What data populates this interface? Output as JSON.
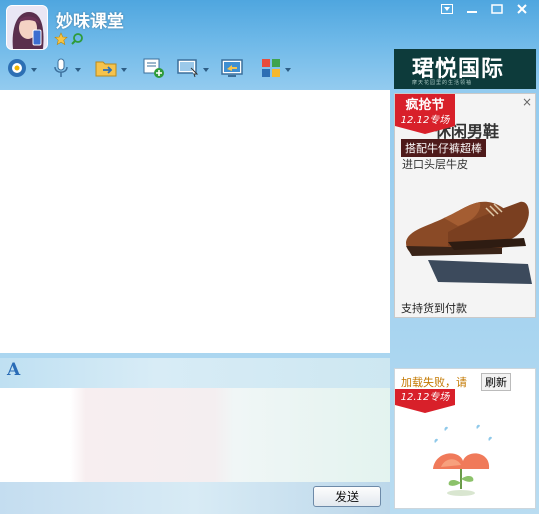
{
  "window": {
    "title": "妙味课堂",
    "controls": [
      {
        "name": "skin-icon"
      },
      {
        "name": "minimize-icon"
      },
      {
        "name": "maximize-icon"
      },
      {
        "name": "close-icon"
      }
    ]
  },
  "toolbar": {
    "tools": [
      {
        "name": "video-call",
        "icon": "camera-icon",
        "dropdown": true
      },
      {
        "name": "voice-call",
        "icon": "microphone-icon",
        "dropdown": true
      },
      {
        "name": "send-file",
        "icon": "folder-icon",
        "dropdown": true
      },
      {
        "name": "message",
        "icon": "message-add-icon",
        "dropdown": false
      },
      {
        "name": "remote-desktop",
        "icon": "screen-icon",
        "dropdown": true
      },
      {
        "name": "share-screen",
        "icon": "monitor-share-icon",
        "dropdown": false
      },
      {
        "name": "apps",
        "icon": "apps-grid-icon",
        "dropdown": true
      }
    ]
  },
  "brand_ad": {
    "title": "珺悦国际",
    "subtitle": "摩天花园里的生活领袖",
    "bg_color": "#0d3b3b"
  },
  "side_ad": {
    "promo_top": "疯抢节",
    "promo_bottom": "12.12专场",
    "headline": "休闲男鞋",
    "tag": "搭配牛仔裤超棒",
    "subline": "进口头层牛皮",
    "footer": "支持货到付款",
    "close": "×"
  },
  "format_bar": {
    "font_button": "A"
  },
  "send_button": {
    "label": "发送"
  },
  "bottom_ad": {
    "fail_text": "加载失败，请",
    "refresh_label": "刷新",
    "promo_bottom": "12.12专场"
  },
  "colors": {
    "accent": "#4fa6df",
    "promo_red": "#d8202a",
    "fail_orange": "#c37800"
  }
}
